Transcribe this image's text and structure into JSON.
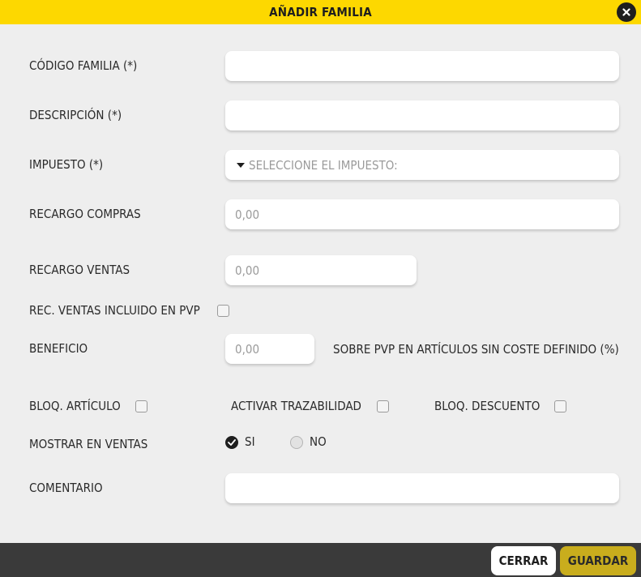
{
  "dialog": {
    "title": "AÑADIR FAMILIA"
  },
  "form": {
    "codigo_label": "CÓDIGO FAMILIA  (*)",
    "codigo_value": "",
    "descripcion_label": "DESCRIPCIÓN  (*)",
    "descripcion_value": "",
    "impuesto_label": "IMPUESTO (*)",
    "impuesto_placeholder": "SELECCIONE EL IMPUESTO:",
    "recargo_compras_label": "RECARGO COMPRAS",
    "recargo_compras_placeholder": "0,00",
    "recargo_ventas_label": "RECARGO VENTAS",
    "recargo_ventas_placeholder": "0,00",
    "rec_ventas_pvp_label": "REC. VENTAS INCLUIDO EN PVP",
    "rec_ventas_pvp_checked": false,
    "beneficio_label": "BENEFICIO",
    "beneficio_placeholder": "0,00",
    "beneficio_note": "SOBRE PVP EN ARTÍCULOS SIN COSTE DEFINIDO (%)",
    "bloq_articulo_label": "BLOQ. ARTÍCULO",
    "bloq_articulo_checked": false,
    "activar_trazabilidad_label": "ACTIVAR TRAZABILIDAD",
    "activar_trazabilidad_checked": false,
    "bloq_descuento_label": "BLOQ. DESCUENTO",
    "bloq_descuento_checked": false,
    "mostrar_ventas_label": "MOSTRAR EN VENTAS",
    "mostrar_ventas_options": [
      "SI",
      "NO"
    ],
    "mostrar_ventas_selected": "SI",
    "comentario_label": "COMENTARIO",
    "comentario_value": ""
  },
  "footer": {
    "cerrar_label": "CERRAR",
    "guardar_label": "GUARDAR"
  },
  "colors": {
    "titlebar": "#fdd800",
    "background": "#eeeeee",
    "footer": "#3a3a3a",
    "guardar": "#c9ad1d"
  },
  "icons": {
    "close": "close-icon",
    "dropdown": "caret-down-icon",
    "radio_checked": "check-icon"
  }
}
